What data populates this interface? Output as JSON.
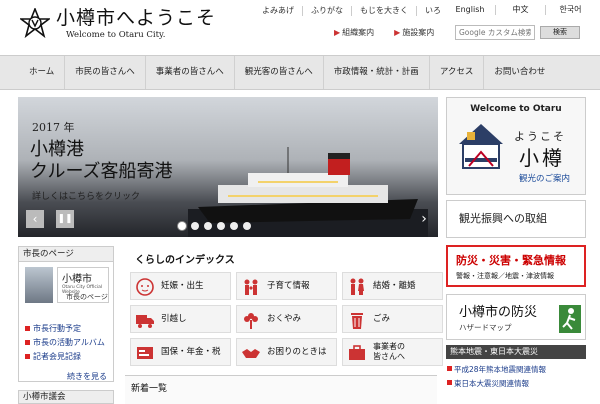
{
  "header": {
    "title": "小樽市へようこそ",
    "subtitle": "Welcome to Otaru City.",
    "utility": [
      "よみあげ",
      "ふりがな",
      "もじを大きく",
      "いろ"
    ],
    "languages": [
      "English",
      "中文",
      "한국어"
    ],
    "links": [
      "組織案内",
      "施設案内"
    ],
    "search_placeholder": "Google カスタム検索",
    "search_button": "検索"
  },
  "nav": [
    "ホーム",
    "市民の皆さんへ",
    "事業者の皆さんへ",
    "観光客の皆さんへ",
    "市政情報・統計・計画",
    "アクセス",
    "お問い合わせ"
  ],
  "hero": {
    "year": "2017 年",
    "title": "小樽港\nクルーズ客船寄港",
    "cta": "詳しくはこちらをクリック",
    "prev": "‹",
    "pause": "❚❚",
    "next": "›",
    "dots": 6,
    "active_dot": 0
  },
  "welcome": {
    "en": "Welcome to Otaru",
    "jp1": "ようこそ",
    "jp2": "小樽",
    "link": "観光のご案内"
  },
  "promo": "観光振興への取組",
  "disaster": {
    "title": "防災・災害・緊急情報",
    "sub": "警報・注意報／地震・津波情報"
  },
  "bousai": {
    "title": "小樽市の防災",
    "sub": "ハザードマップ"
  },
  "quake": {
    "title": "熊本地震・東日本大震災",
    "links": [
      "平成28年熊本地震関連情報",
      "東日本大震災関連情報"
    ]
  },
  "mayor": {
    "title": "市長のページ",
    "card_title": "小樽市",
    "card_sub": "Otaru City Official Website",
    "card_label": "市長のページ",
    "links": [
      "市長行動予定",
      "市長の活動アルバム",
      "記者会見記録"
    ],
    "more": "続きを見る"
  },
  "council": "小樽市議会",
  "life": {
    "title": "くらしのインデックス",
    "tiles": [
      {
        "label": "妊娠・出生",
        "icon": "baby-icon"
      },
      {
        "label": "子育て情報",
        "icon": "family-icon"
      },
      {
        "label": "結婚・離婚",
        "icon": "couple-icon"
      },
      {
        "label": "引越し",
        "icon": "truck-icon"
      },
      {
        "label": "おくやみ",
        "icon": "flower-icon"
      },
      {
        "label": "ごみ",
        "icon": "trash-icon"
      },
      {
        "label": "国保・年金・税",
        "icon": "health-card-icon"
      },
      {
        "label": "お困りのときは",
        "icon": "handshake-icon"
      },
      {
        "label": "事業者の\n皆さんへ",
        "icon": "briefcase-icon"
      }
    ]
  },
  "news": {
    "title": "新着一覧"
  },
  "colors": {
    "accent": "#d22222",
    "link": "#1a3b8a",
    "nav_bg": "#e7e7e7",
    "icon_red": "#c33",
    "tile_bg": "#f4f4f4"
  }
}
